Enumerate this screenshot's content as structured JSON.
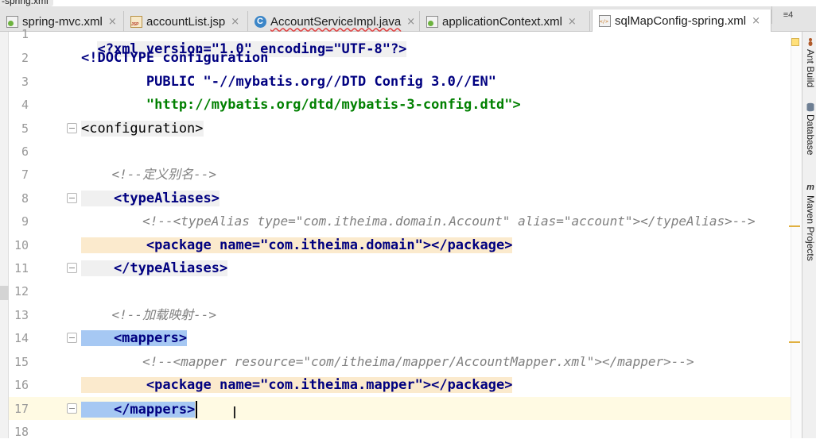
{
  "window": {
    "title_fragment": "-spring.xml"
  },
  "tabs": [
    {
      "label": "spring-mvc.xml",
      "icon": "xml-spring-icon",
      "closable": true,
      "active": false,
      "error": false
    },
    {
      "label": "accountList.jsp",
      "icon": "jsp-file-icon",
      "closable": true,
      "active": false,
      "error": false
    },
    {
      "label": "AccountServiceImpl.java",
      "icon": "java-class-icon",
      "closable": true,
      "active": false,
      "error": true
    },
    {
      "label": "applicationContext.xml",
      "icon": "xml-spring-icon",
      "closable": true,
      "active": false,
      "error": false
    },
    {
      "label": "sqlMapConfig-spring.xml",
      "icon": "xml-file-icon",
      "closable": true,
      "active": true,
      "error": false
    }
  ],
  "tab_overflow": {
    "label": "≡4"
  },
  "close_glyph": "×",
  "editor": {
    "current_line": 17,
    "lines": [
      {
        "n": "1",
        "text": "<?xml version=\"1.0\" encoding=\"UTF-8\"?>"
      },
      {
        "n": "2",
        "text": "<!DOCTYPE configuration"
      },
      {
        "n": "3",
        "text": "        PUBLIC \"-//mybatis.org//DTD Config 3.0//EN\""
      },
      {
        "n": "4",
        "text": "        \"http://mybatis.org/dtd/mybatis-3-config.dtd\">"
      },
      {
        "n": "5",
        "text": "<configuration>"
      },
      {
        "n": "6",
        "text": ""
      },
      {
        "n": "7",
        "text": "    <!--定义别名-->"
      },
      {
        "n": "8",
        "text": "    <typeAliases>"
      },
      {
        "n": "9",
        "text": "        <!--<typeAlias type=\"com.itheima.domain.Account\" alias=\"account\"></typeAlias>-->"
      },
      {
        "n": "10",
        "text": "        <package name=\"com.itheima.domain\"></package>"
      },
      {
        "n": "11",
        "text": "    </typeAliases>"
      },
      {
        "n": "12",
        "text": ""
      },
      {
        "n": "13",
        "text": "    <!--加载映射-->"
      },
      {
        "n": "14",
        "text": "    <mappers>"
      },
      {
        "n": "15",
        "text": "        <!--<mapper resource=\"com/itheima/mapper/AccountMapper.xml\"></mapper>-->"
      },
      {
        "n": "16",
        "text": "        <package name=\"com.itheima.mapper\"></package>"
      },
      {
        "n": "17",
        "text": "    </mappers>"
      },
      {
        "n": "18",
        "text": ""
      }
    ]
  },
  "right_tool_windows": [
    {
      "label": "Ant Build",
      "icon": "ant-icon"
    },
    {
      "label": "Database",
      "icon": "database-icon"
    },
    {
      "label": "Maven Projects",
      "icon": "maven-icon"
    }
  ],
  "colors": {
    "tag": "#000080",
    "attribute": "#0000ff",
    "string": "#008000",
    "comment": "#808080",
    "current_line": "#fffae3",
    "tag_match": "#fbeacd",
    "selection": "#a6c8f3"
  }
}
